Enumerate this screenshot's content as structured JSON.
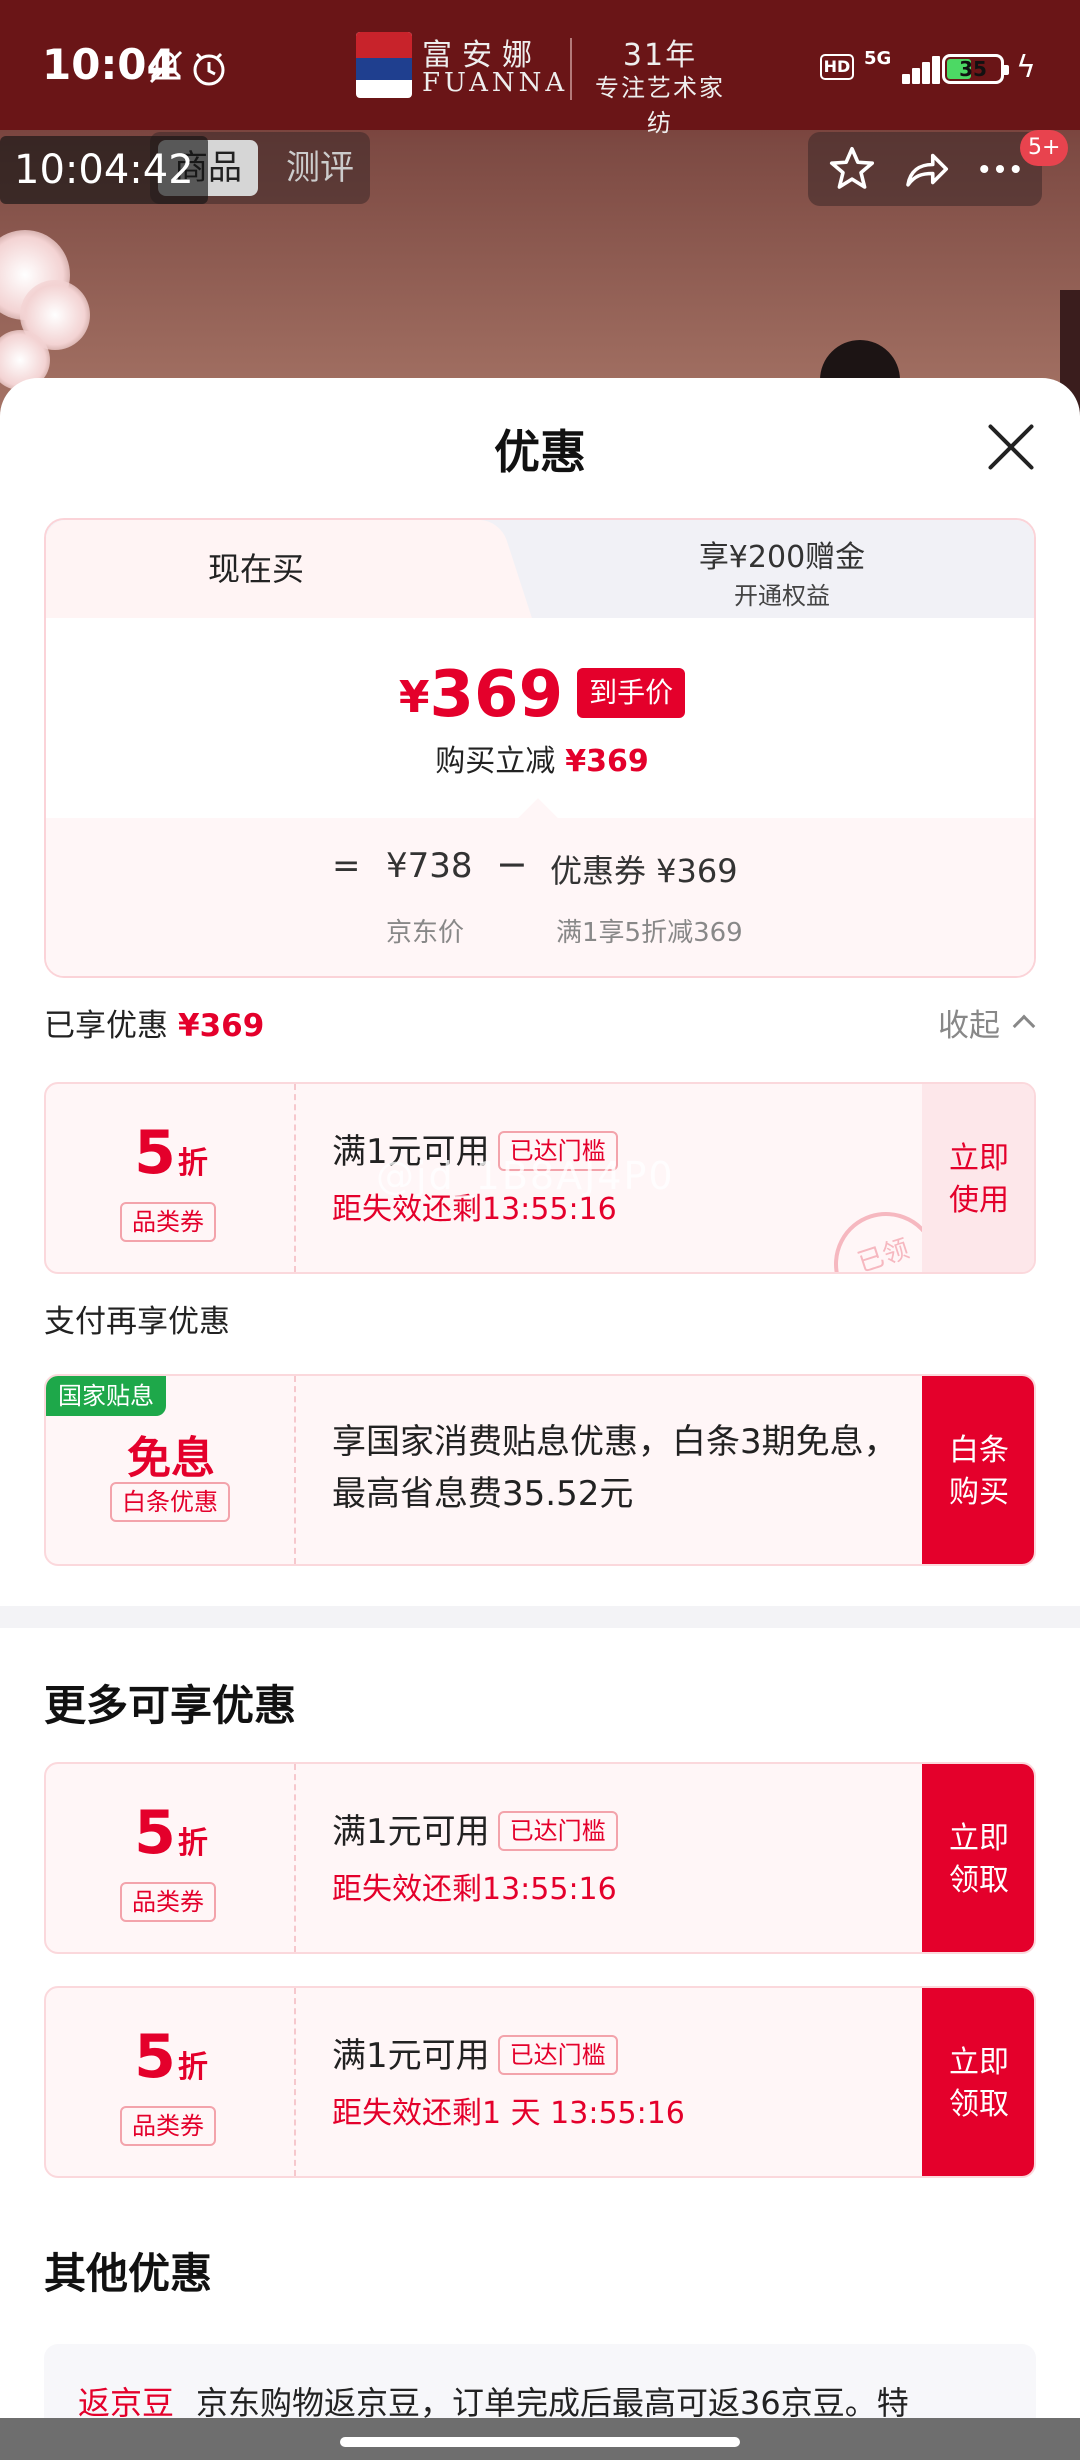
{
  "status_bar": {
    "time": "10:04",
    "hd": "HD",
    "network": "5G",
    "battery": "35"
  },
  "brand": {
    "name_cn": "富安娜",
    "name_en": "FUANNA",
    "years": "31年",
    "slogan": "专注艺术家纺"
  },
  "overlay_time": "10:04:42",
  "product_tabs": [
    "商品",
    "测评"
  ],
  "notification_badge": "5+",
  "sheet": {
    "title": "优惠",
    "price_card": {
      "tab_now": "现在买",
      "tab_other_line1": "享¥200赠金",
      "tab_other_line2": "开通权益",
      "currency": "¥",
      "final_price": "369",
      "final_price_tag": "到手价",
      "instant_reduce_label": "购买立减",
      "instant_reduce_value": "¥369",
      "equals": "=",
      "jd_price": "¥738",
      "minus": "−",
      "coupon_value": "优惠券 ¥369",
      "jd_price_label": "京东价",
      "coupon_label": "满1享5折减369"
    },
    "enjoyed": {
      "label": "已享优惠",
      "value": "¥369",
      "collapse": "收起"
    },
    "coupon_enjoyed": {
      "discount": "5",
      "unit": "折",
      "type": "品类券",
      "condition": "满1元可用",
      "threshold": "已达门槛",
      "expiry": "距失效还剩13:55:16",
      "button": [
        "立即",
        "使用"
      ],
      "stamp": "已领",
      "watermark": "@jd_1B8AJ4P0"
    },
    "pay_section_title": "支付再享优惠",
    "baitiao": {
      "gov_tag": "国家贴息",
      "big": "免息",
      "type": "白条优惠",
      "text": "享国家消费贴息优惠，白条3期免息，最高省息费35.52元",
      "button": [
        "白条",
        "购买"
      ]
    },
    "more_title": "更多可享优惠",
    "more_coupons": [
      {
        "discount": "5",
        "unit": "折",
        "type": "品类券",
        "condition": "满1元可用",
        "threshold": "已达门槛",
        "expiry": "距失效还剩13:55:16",
        "button": [
          "立即",
          "领取"
        ]
      },
      {
        "discount": "5",
        "unit": "折",
        "type": "品类券",
        "condition": "满1元可用",
        "threshold": "已达门槛",
        "expiry": "距失效还剩1 天 13:55:16",
        "button": [
          "立即",
          "领取"
        ]
      }
    ],
    "other_title": "其他优惠",
    "other_item": {
      "tag": "返京豆",
      "text": "京东购物返京豆，订单完成后最高可返36京豆。特"
    }
  },
  "colors": {
    "accent_red": "#e4002b",
    "gov_green": "#1ea84a",
    "header_bg": "#6a1517"
  }
}
